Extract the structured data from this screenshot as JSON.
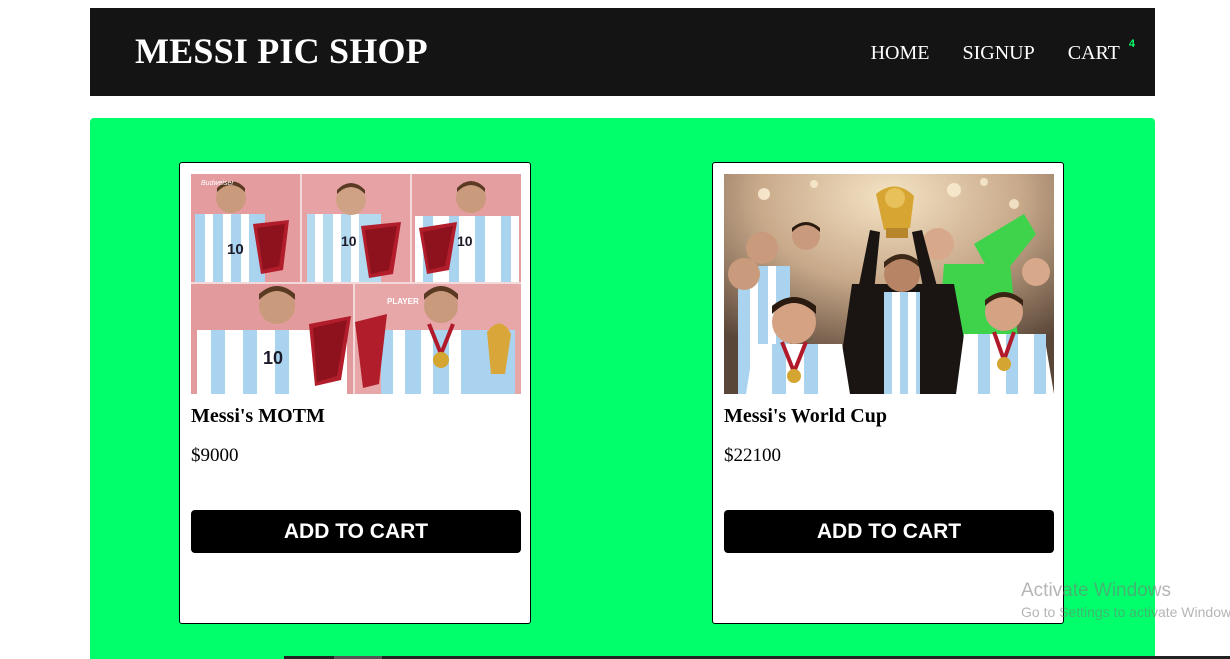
{
  "header": {
    "brand": "MESSI PIC SHOP",
    "nav": {
      "home": "HOME",
      "signup": "SIGNUP",
      "cart": "CART",
      "cart_count": "4"
    }
  },
  "colors": {
    "header_bg": "#141414",
    "main_bg": "#00ff6a",
    "button_bg": "#000000",
    "cart_count": "#00ff6a"
  },
  "products": [
    {
      "title": "Messi's MOTM",
      "price": "$9000",
      "button": "ADD TO CART",
      "image": "messi-motm-collage-photo"
    },
    {
      "title": "Messi's World Cup",
      "price": "$22100",
      "button": "ADD TO CART",
      "image": "messi-world-cup-celebration-photo"
    }
  ],
  "watermark": {
    "line1": "Activate Windows",
    "line2": "Go to Settings to activate Windows."
  }
}
